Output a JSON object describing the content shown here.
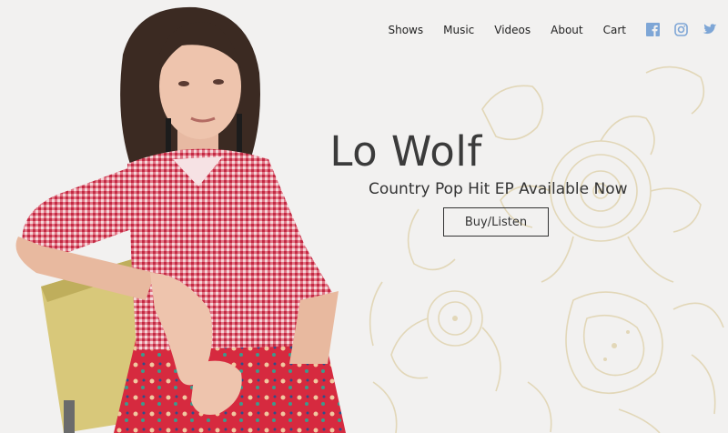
{
  "nav": {
    "items": [
      "Shows",
      "Music",
      "Videos",
      "About",
      "Cart"
    ],
    "social": [
      {
        "icon": "facebook-icon",
        "color": "#7ea6d6"
      },
      {
        "icon": "instagram-icon",
        "color": "#7ea6d6"
      },
      {
        "icon": "twitter-icon",
        "color": "#7ea6d6"
      }
    ]
  },
  "hero": {
    "title": "Lo Wolf",
    "subtitle": "Country Pop Hit EP Available Now",
    "button_label": "Buy/Listen",
    "photo_icon": "artist-photo",
    "ornament_icon": "henna-ornament"
  },
  "colors": {
    "background": "#f2f1f0",
    "text": "#333333",
    "social": "#7ea6d6",
    "ornament": "#e2d7b8"
  }
}
